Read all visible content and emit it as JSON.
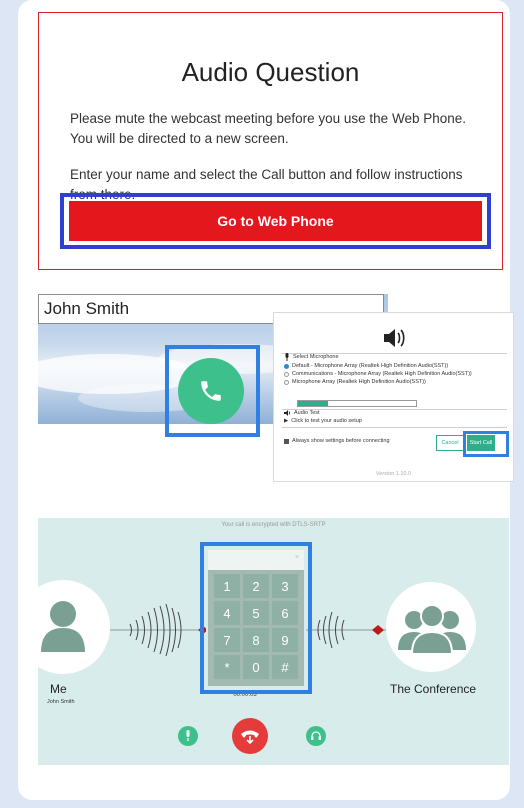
{
  "audio_question": {
    "title": "Audio Question",
    "paragraph1": "Please mute the webcast meeting before you use the Web Phone. You will be directed to a new screen.",
    "paragraph2": "Enter your name and select the Call button and follow instructions from there.",
    "button_label": "Go to Web Phone"
  },
  "name_entry": {
    "name_value": "John Smith"
  },
  "audio_settings": {
    "select_microphone_label": "Select Microphone",
    "options": [
      "Default - Microphone Array (Realtek High Definition Audio(SST))",
      "Communications - Microphone Array (Realtek High Definition Audio(SST))",
      "Microphone Array (Realtek High Definition Audio(SST))"
    ],
    "selected_index": 0,
    "audio_test_label": "Audio Test",
    "test_link": "Click to test your audio setup",
    "always_show_label": "Always show settings before connecting",
    "cancel_label": "Cancel",
    "start_call_label": "Start Call",
    "version": "Version 1.10.0",
    "level_fraction": 0.25
  },
  "conference": {
    "encryption_notice": "Your call is encrypted with DTLS-SRTP",
    "me_label": "Me",
    "me_name": "John Smith",
    "conference_label": "The Conference",
    "timer": "00:00:03",
    "keypad_close": "×",
    "keys": [
      "1",
      "2",
      "3",
      "4",
      "5",
      "6",
      "7",
      "8",
      "9",
      "*",
      "0",
      "#"
    ]
  },
  "colors": {
    "red": "#e3171c",
    "highlight_blue": "#2f3fd0",
    "call_green": "#3ec08c",
    "keypad": "#a2bab1"
  }
}
